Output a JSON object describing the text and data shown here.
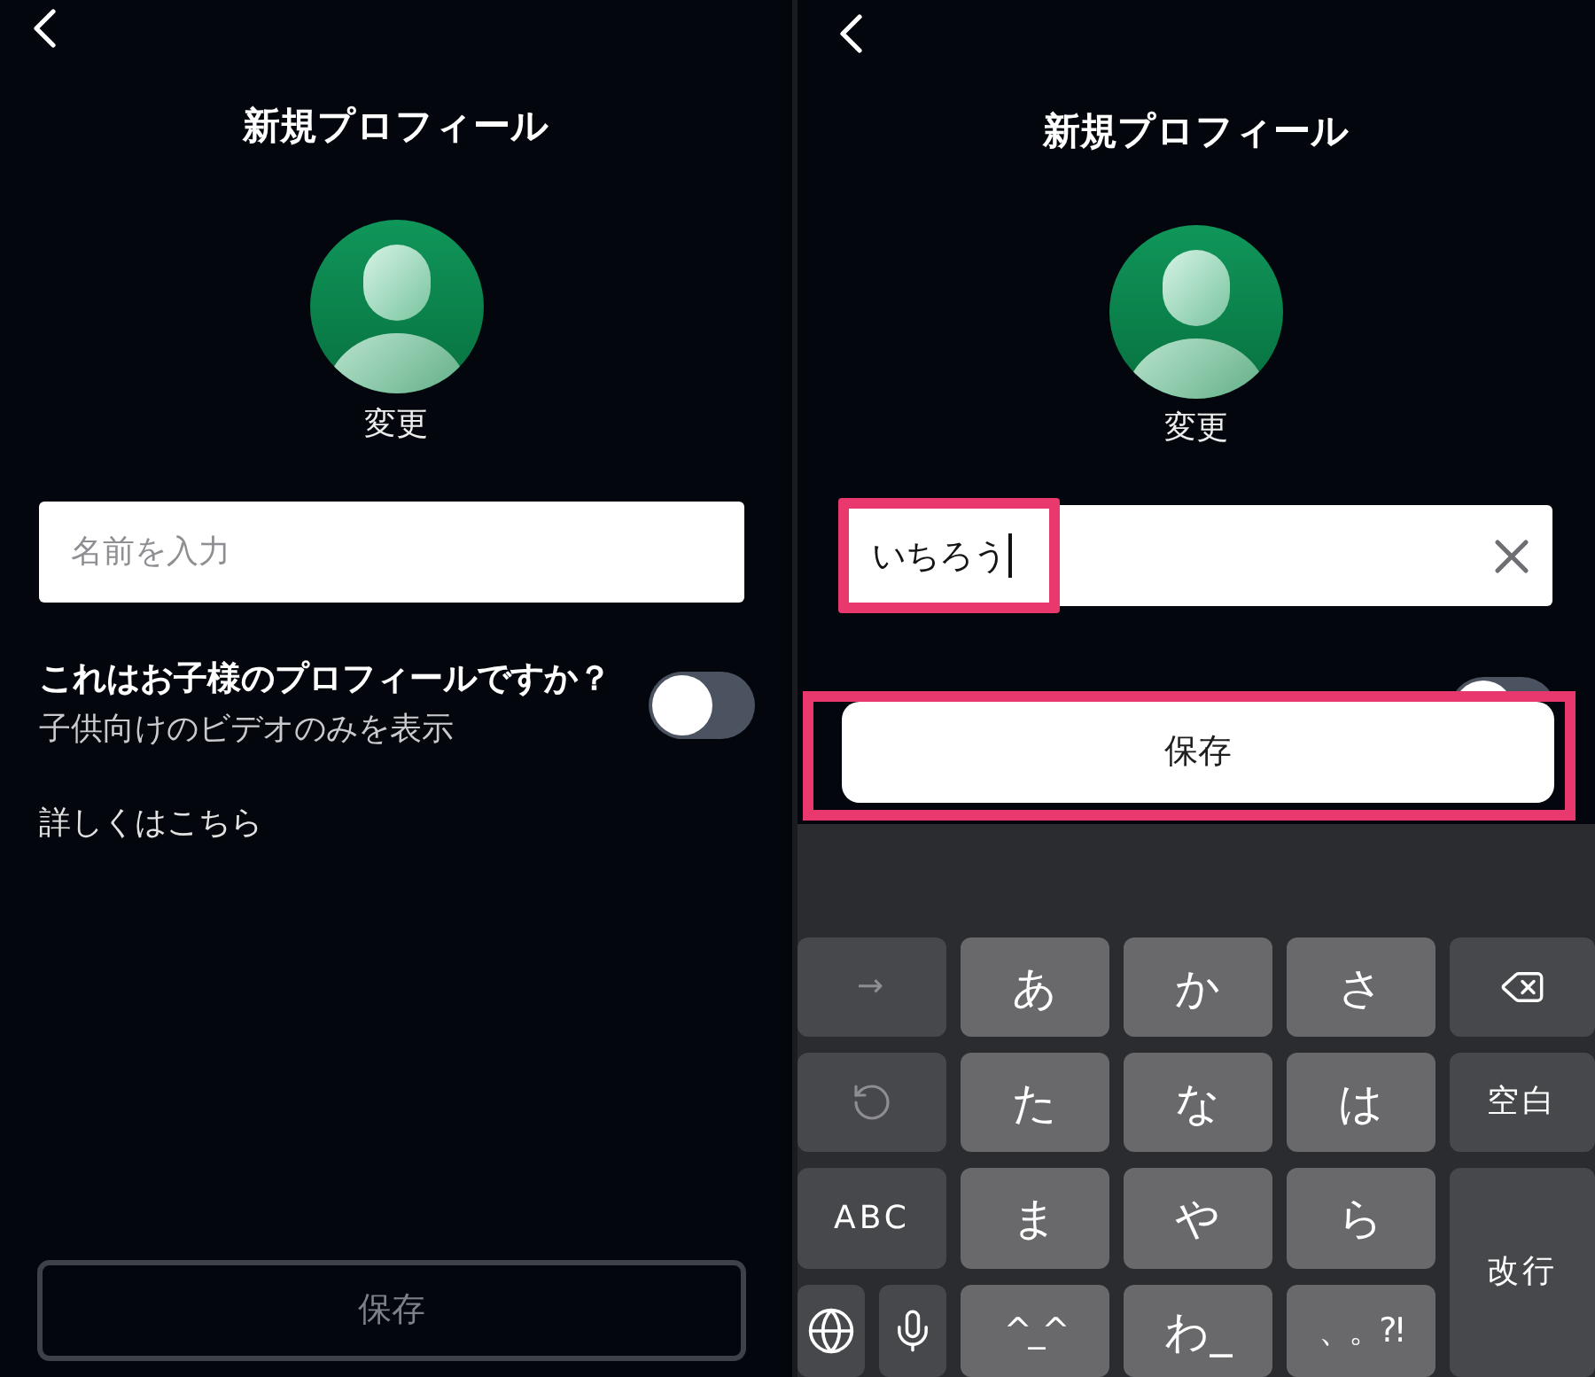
{
  "screens": [
    {
      "title": "新規プロフィール",
      "avatar_link": "変更",
      "name_field": {
        "placeholder": "名前を入力"
      },
      "child_profile": {
        "question": "これはお子様のプロフィールですか？",
        "description": "子供向けのビデオのみを表示",
        "on": false
      },
      "learn_more_link": "詳しくはこちら",
      "save_button": {
        "label": "保存",
        "disabled": true
      }
    },
    {
      "title": "新規プロフィール",
      "avatar_link": "変更",
      "name_field": {
        "value": "いちろう",
        "highlighted": true
      },
      "child_profile": {
        "on": false
      },
      "save_button": {
        "label": "保存",
        "disabled": false,
        "highlighted": true
      },
      "keyboard": {
        "rows": [
          [
            {
              "kind": "function",
              "label": "→",
              "disabled": true
            },
            {
              "kind": "kana",
              "label": "あ",
              "disabled": false
            },
            {
              "kind": "kana",
              "label": "か",
              "disabled": false
            },
            {
              "kind": "kana",
              "label": "さ",
              "disabled": false
            },
            {
              "kind": "backspace",
              "disabled": false
            }
          ],
          [
            {
              "kind": "undo",
              "disabled": true
            },
            {
              "kind": "kana",
              "label": "た",
              "disabled": false
            },
            {
              "kind": "kana",
              "label": "な",
              "disabled": false
            },
            {
              "kind": "kana",
              "label": "は",
              "disabled": false
            },
            {
              "kind": "function",
              "label": "空白",
              "disabled": false
            }
          ],
          [
            {
              "kind": "function",
              "label": "ABC",
              "disabled": false
            },
            {
              "kind": "kana",
              "label": "ま",
              "disabled": false
            },
            {
              "kind": "kana",
              "label": "や",
              "disabled": false
            },
            {
              "kind": "kana",
              "label": "ら",
              "disabled": false
            },
            {
              "kind": "return",
              "label": "改行",
              "disabled": false
            }
          ],
          [
            {
              "kind": "group",
              "keys": [
                {
                  "kind": "globe",
                  "disabled": false
                },
                {
                  "kind": "mic",
                  "disabled": false
                }
              ]
            },
            {
              "kind": "symbol",
              "label": "^_^",
              "disabled": false
            },
            {
              "kind": "kana",
              "label": "わ_",
              "disabled": false
            },
            {
              "kind": "symbol",
              "label": "、。?!",
              "disabled": false
            }
          ]
        ]
      }
    }
  ]
}
